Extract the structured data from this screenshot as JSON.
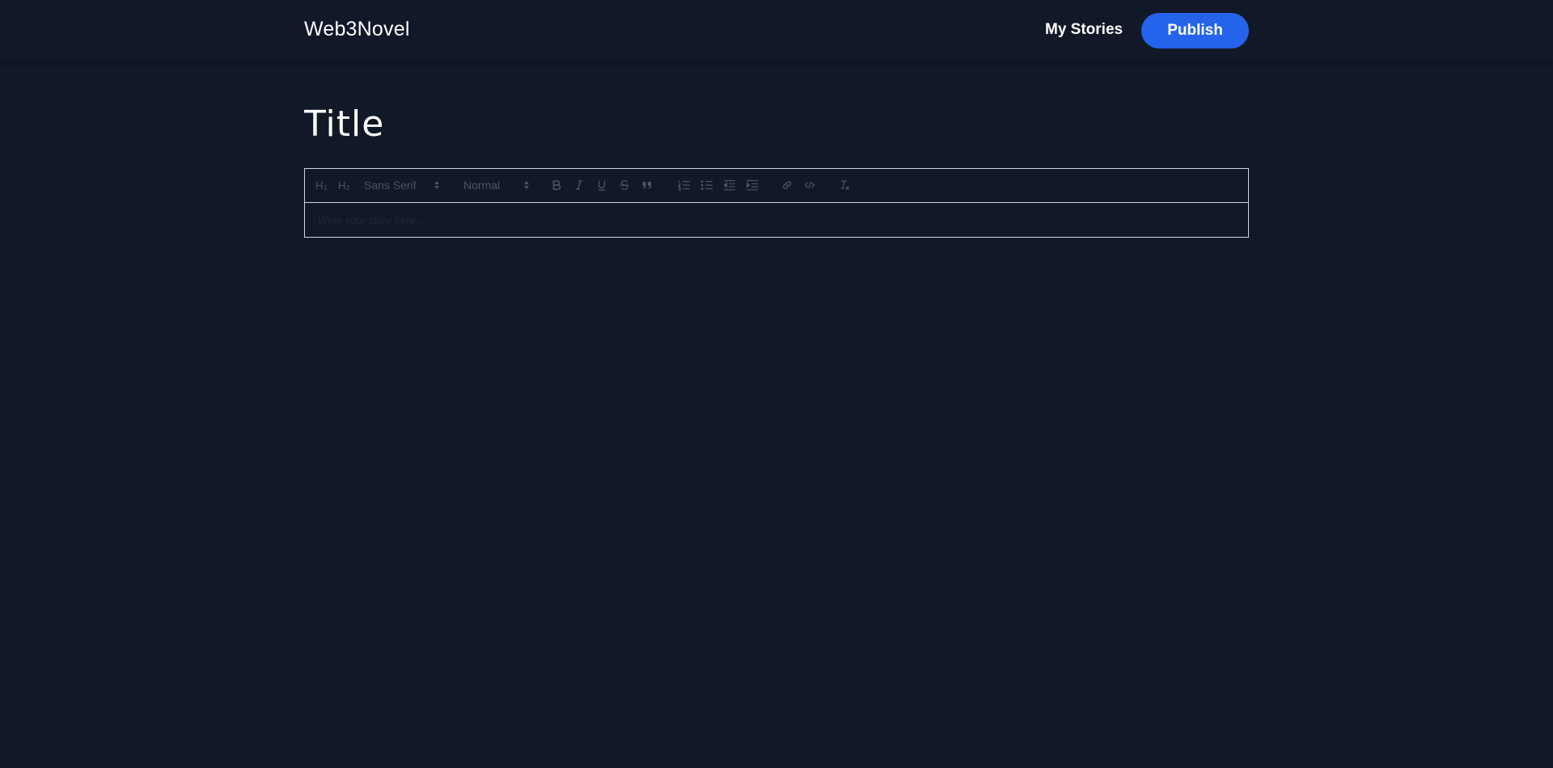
{
  "navbar": {
    "brand": "Web3Novel",
    "my_stories_label": "My Stories",
    "publish_label": "Publish",
    "publish_color": "#2563eb"
  },
  "story": {
    "title_placeholder": "Title"
  },
  "editor": {
    "toolbar": {
      "header1": "H1",
      "header2": "H2",
      "font_picker_value": "Sans Serif",
      "size_picker_value": "Normal",
      "icons": [
        "h1-icon",
        "h2-icon",
        "bold-icon",
        "italic-icon",
        "underline-icon",
        "strike-icon",
        "blockquote-icon",
        "ordered-list-icon",
        "bullet-list-icon",
        "outdent-icon",
        "indent-icon",
        "link-icon",
        "code-icon",
        "clear-format-icon"
      ]
    },
    "content_placeholder": "Write your story here..."
  },
  "colors": {
    "background": "#111827",
    "accent": "#2563eb",
    "border": "#d1d5db"
  }
}
